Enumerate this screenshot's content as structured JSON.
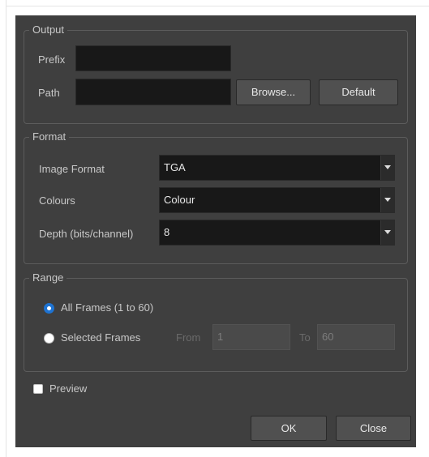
{
  "output": {
    "title": "Output",
    "prefix_label": "Prefix",
    "prefix_value": "",
    "path_label": "Path",
    "path_value": "",
    "browse_label": "Browse...",
    "default_label": "Default"
  },
  "format": {
    "title": "Format",
    "image_format_label": "Image Format",
    "image_format_value": "TGA",
    "colours_label": "Colours",
    "colours_value": "Colour",
    "depth_label": "Depth (bits/channel)",
    "depth_value": "8"
  },
  "range": {
    "title": "Range",
    "all_frames_label": "All Frames (1 to 60)",
    "all_frames_selected": true,
    "selected_frames_label": "Selected Frames",
    "selected_frames_selected": false,
    "from_label": "From",
    "from_value": "1",
    "to_label": "To",
    "to_value": "60"
  },
  "preview": {
    "label": "Preview",
    "checked": false
  },
  "buttons": {
    "ok_label": "OK",
    "close_label": "Close"
  },
  "colors": {
    "dialog_bg": "#3f3f3f",
    "field_bg": "#181818",
    "radio_accent": "#1e73d2"
  }
}
